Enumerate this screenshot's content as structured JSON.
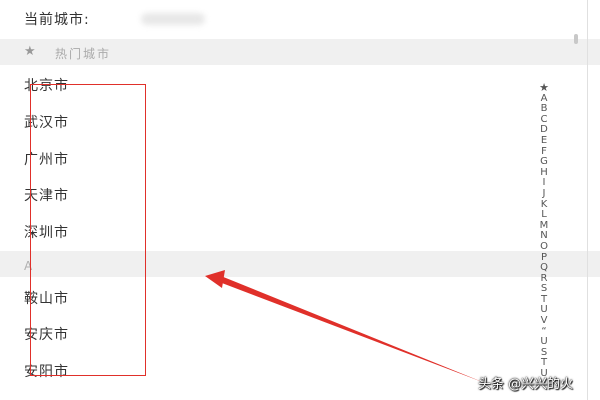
{
  "current_city": {
    "label": "当前城市:"
  },
  "hot_section": {
    "icon": "star-icon",
    "star_glyph": "★",
    "title": "热门城市"
  },
  "hot_cities": [
    "北京市",
    "武汉市",
    "广州市",
    "天津市",
    "深圳市"
  ],
  "a_section": {
    "letter": "A"
  },
  "a_cities": [
    "鞍山市",
    "安庆市",
    "安阳市"
  ],
  "index_bar": [
    "★",
    "A",
    "B",
    "C",
    "D",
    "E",
    "F",
    "G",
    "H",
    "I",
    "J",
    "K",
    "L",
    "M",
    "N",
    "O",
    "P",
    "Q",
    "R",
    "S",
    "T",
    "U",
    "V",
    "“",
    "U",
    "S",
    "T",
    "U"
  ],
  "watermark": "头条 @兴兴的火",
  "colors": {
    "annotation": "#e0302a",
    "section_bg": "#f0f0f0",
    "text": "#333333"
  }
}
